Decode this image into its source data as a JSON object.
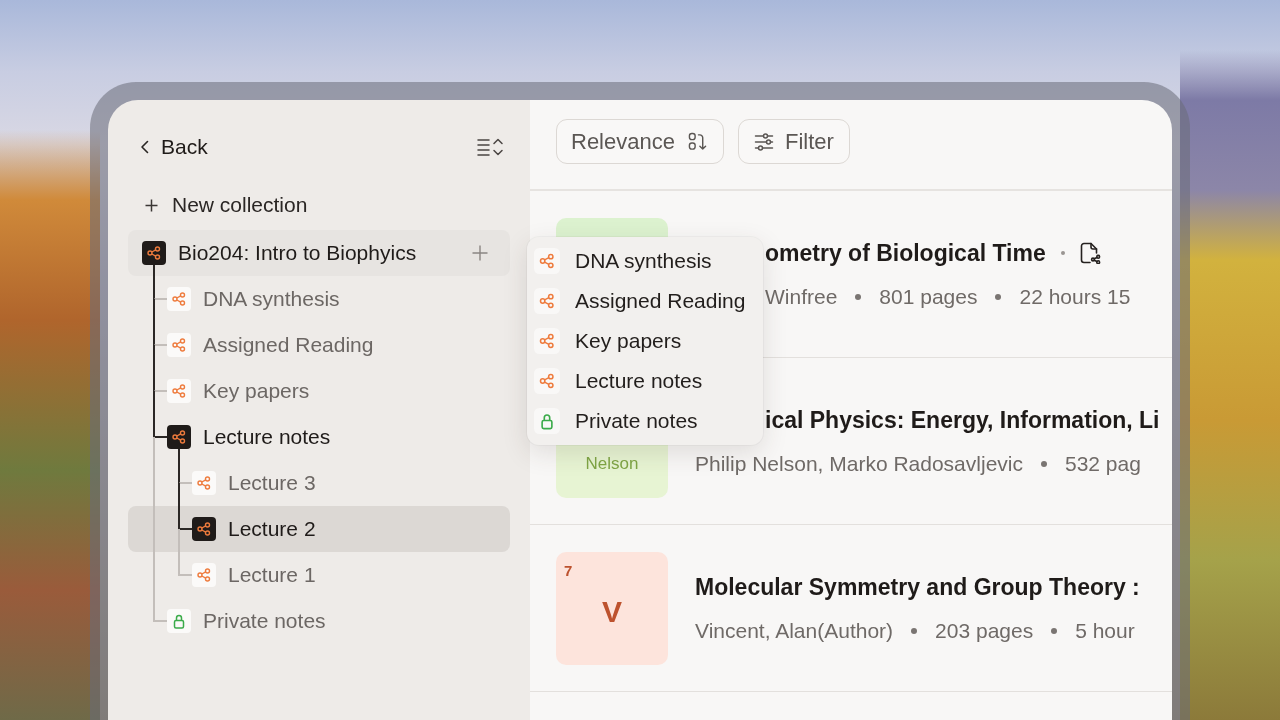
{
  "sidebar": {
    "back": "Back",
    "new_collection": "New collection",
    "tree": [
      {
        "label": "Bio204: Intro to Biophyics",
        "kind": "shared",
        "selected": false,
        "hovered": true,
        "children": [
          {
            "label": "DNA synthesis",
            "kind": "shared",
            "selected": false,
            "hovered": false
          },
          {
            "label": "Assigned Reading",
            "kind": "shared",
            "selected": false,
            "hovered": false
          },
          {
            "label": "Key papers",
            "kind": "shared",
            "selected": false,
            "hovered": false
          },
          {
            "label": "Lecture notes",
            "kind": "shared",
            "selected": false,
            "hovered": false,
            "children": [
              {
                "label": "Lecture 3",
                "kind": "shared",
                "selected": false,
                "hovered": false
              },
              {
                "label": "Lecture 2",
                "kind": "shared",
                "selected": true,
                "hovered": false
              },
              {
                "label": "Lecture 1",
                "kind": "shared",
                "selected": false,
                "hovered": false
              }
            ]
          },
          {
            "label": "Private notes",
            "kind": "private",
            "selected": false,
            "hovered": false
          }
        ]
      }
    ]
  },
  "toolbar": {
    "sort": "Relevance",
    "filter": "Filter"
  },
  "menu": {
    "items": [
      {
        "label": "DNA synthesis",
        "kind": "shared"
      },
      {
        "label": "Assigned Reading",
        "kind": "shared"
      },
      {
        "label": "Key papers",
        "kind": "shared"
      },
      {
        "label": "Lecture notes",
        "kind": "shared"
      },
      {
        "label": "Private notes",
        "kind": "private"
      }
    ]
  },
  "results": [
    {
      "cover": {
        "color": "#dcf2cf"
      },
      "title": "ometry of Biological Time",
      "shared": true,
      "meta": [
        "Winfree",
        "801 pages",
        "22 hours 15"
      ]
    },
    {
      "cover": {
        "color": "#e7f4d3",
        "caption": "Nelson"
      },
      "title": "ical Physics: Energy, Information, Li",
      "shared": false,
      "meta": [
        "Philip Nelson, Marko Radosavljevic",
        "532 pag"
      ]
    },
    {
      "cover": {
        "color": "#fde4dc",
        "badge": "7",
        "letter": "V"
      },
      "title": "Molecular Symmetry and Group Theory :",
      "shared": false,
      "meta": [
        "Vincent, Alan(Author)",
        "203 pages",
        "5 hour"
      ]
    }
  ]
}
